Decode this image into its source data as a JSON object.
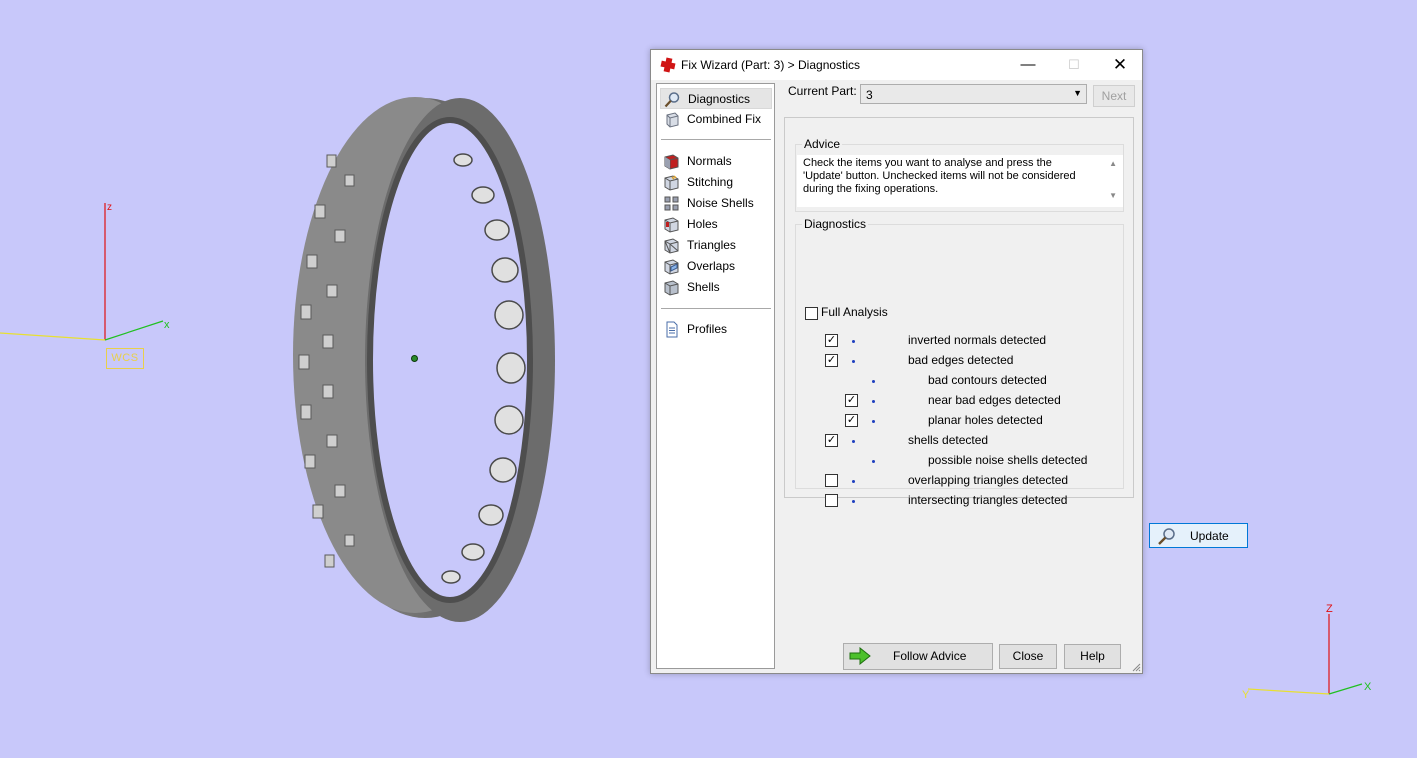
{
  "viewport": {
    "wcs_label": "WCS",
    "axis_left": {
      "z": "z",
      "x": "x"
    },
    "axis_right": {
      "z": "Z",
      "y": "Y",
      "x": "X"
    },
    "model_icon": "ring-part-3d"
  },
  "dialog": {
    "title": "Fix Wizard (Part: 3) > Diagnostics",
    "title_icon": "red-cross-icon",
    "nav": {
      "top_items": [
        {
          "label": "Diagnostics",
          "icon": "magnifier-icon",
          "selected": true
        },
        {
          "label": "Combined Fix",
          "icon": "cube-icon"
        }
      ],
      "mid_items": [
        {
          "label": "Normals",
          "icon": "normals-icon"
        },
        {
          "label": "Stitching",
          "icon": "stitching-icon"
        },
        {
          "label": "Noise Shells",
          "icon": "noise-shells-icon"
        },
        {
          "label": "Holes",
          "icon": "holes-icon"
        },
        {
          "label": "Triangles",
          "icon": "triangles-icon"
        },
        {
          "label": "Overlaps",
          "icon": "overlaps-icon"
        },
        {
          "label": "Shells",
          "icon": "shells-icon"
        }
      ],
      "bottom_items": [
        {
          "label": "Profiles",
          "icon": "document-icon"
        }
      ]
    },
    "current_part_label": "Current Part:",
    "current_part_value": "3",
    "next_label": "Next",
    "advice": {
      "title": "Advice",
      "text": "Check the items you want to analyse and press the 'Update' button. Unchecked items will not be considered during the fixing operations."
    },
    "diagnostics": {
      "title": "Diagnostics",
      "full_analysis_label": "Full Analysis",
      "full_analysis_checked": false,
      "items": [
        {
          "label": "inverted normals detected",
          "checked": true,
          "has_checkbox": true,
          "indent": 0
        },
        {
          "label": "bad edges detected",
          "checked": true,
          "has_checkbox": true,
          "indent": 0
        },
        {
          "label": "bad contours detected",
          "checked": false,
          "has_checkbox": false,
          "indent": 1
        },
        {
          "label": "near bad edges detected",
          "checked": true,
          "has_checkbox": true,
          "indent": 1
        },
        {
          "label": "planar holes detected",
          "checked": true,
          "has_checkbox": true,
          "indent": 1
        },
        {
          "label": "shells detected",
          "checked": true,
          "has_checkbox": true,
          "indent": 0
        },
        {
          "label": "possible noise shells detected",
          "checked": false,
          "has_checkbox": false,
          "indent": 1
        },
        {
          "label": "overlapping triangles detected",
          "checked": false,
          "has_checkbox": true,
          "indent": 0
        },
        {
          "label": "intersecting triangles detected",
          "checked": false,
          "has_checkbox": true,
          "indent": 0
        }
      ],
      "update_label": "Update"
    },
    "follow_advice_label": "Follow Advice",
    "close_label": "Close",
    "help_label": "Help",
    "colors": {
      "bullet": "#1e3fbf",
      "focus": "#0078d7",
      "background": "#c8c8fa"
    }
  }
}
